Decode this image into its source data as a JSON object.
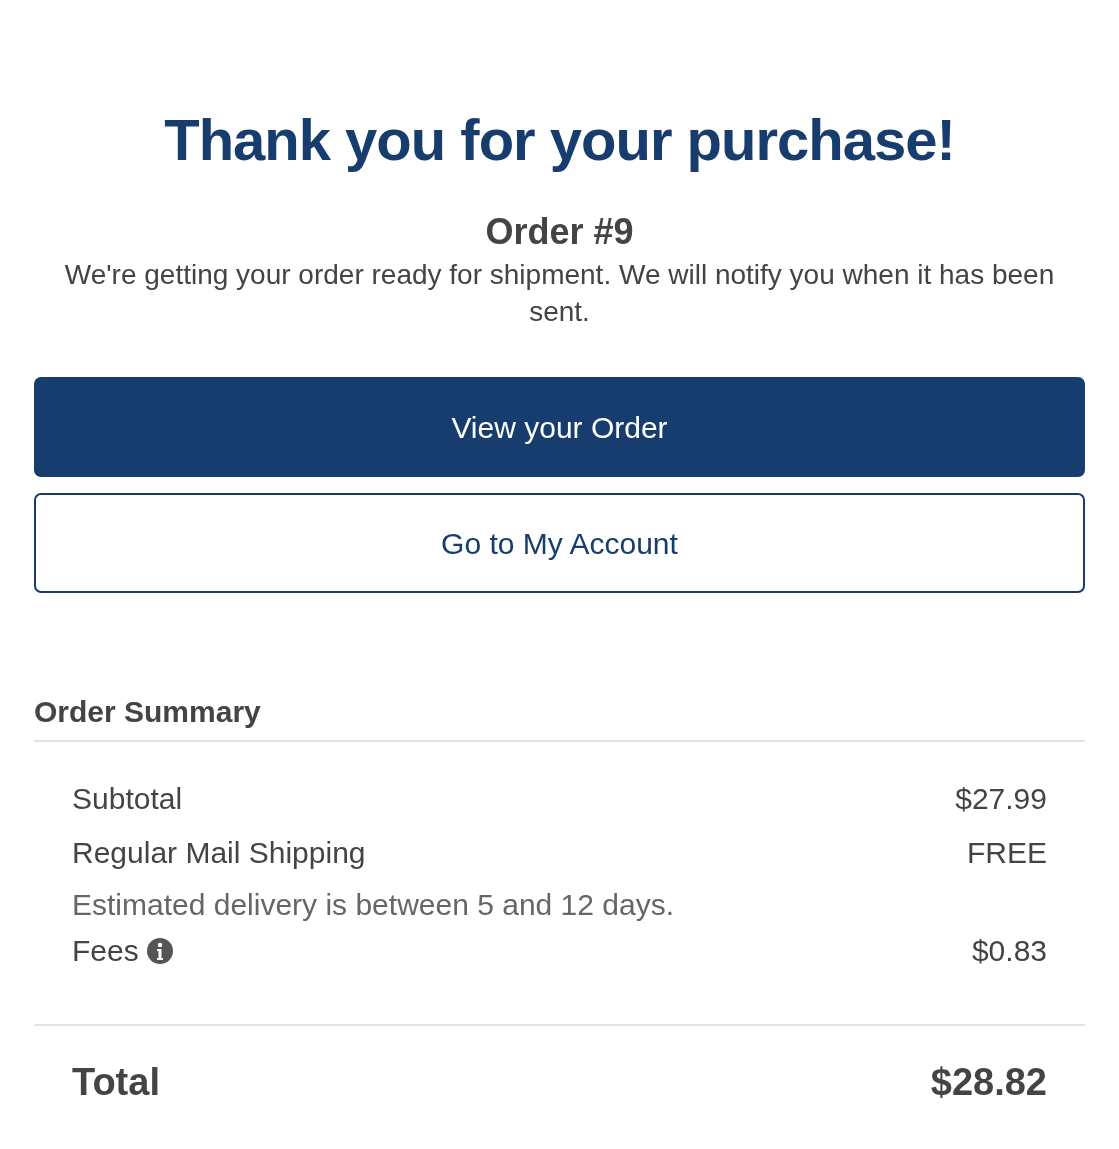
{
  "heading": "Thank you for your purchase!",
  "order_number": "Order #9",
  "message": "We're getting your order ready for shipment. We will notify you when it has been sent.",
  "buttons": [
    {
      "label": "View your Order",
      "kind": "primary"
    },
    {
      "label": "Go to My Account",
      "kind": "outline"
    }
  ],
  "summary": {
    "title": "Order Summary",
    "lines": [
      {
        "label": "Subtotal",
        "value": "$27.99"
      },
      {
        "label": "Regular Mail Shipping",
        "value": "FREE",
        "note": "Estimated delivery is between 5 and 12 days."
      },
      {
        "label": "Fees",
        "value": "$0.83",
        "info": true
      }
    ],
    "total": {
      "label": "Total",
      "value": "$28.82"
    }
  }
}
